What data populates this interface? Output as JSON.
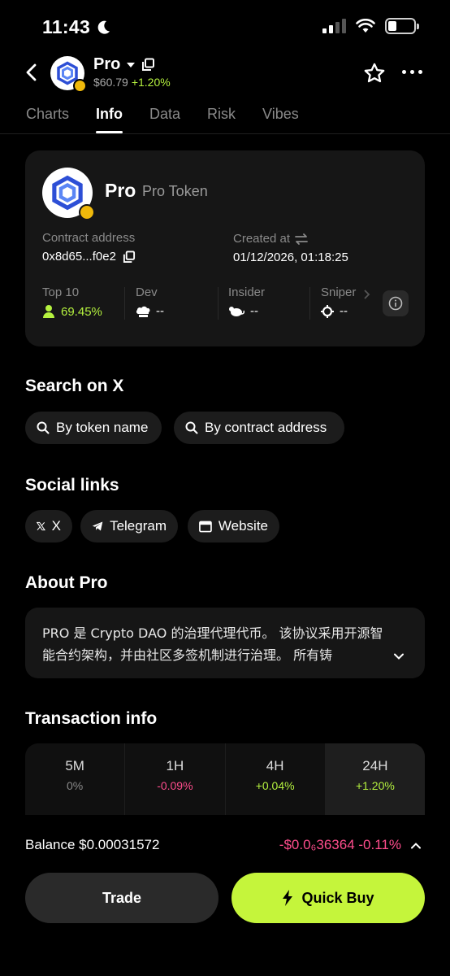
{
  "status_bar": {
    "time": "11:43"
  },
  "header": {
    "symbol": "Pro",
    "price": "$60.79",
    "change": "+1.20%"
  },
  "tabs": [
    {
      "label": "Charts",
      "active": false
    },
    {
      "label": "Info",
      "active": true
    },
    {
      "label": "Data",
      "active": false
    },
    {
      "label": "Risk",
      "active": false
    },
    {
      "label": "Vibes",
      "active": false
    }
  ],
  "token_card": {
    "symbol": "Pro",
    "full_name": "Pro Token",
    "contract_label": "Contract address",
    "contract_value": "0x8d65...f0e2",
    "created_label": "Created at",
    "created_value": "01/12/2026, 01:18:25",
    "stats": [
      {
        "label": "Top 10",
        "value": "69.45%"
      },
      {
        "label": "Dev",
        "value": "--"
      },
      {
        "label": "Insider",
        "value": "--"
      },
      {
        "label": "Sniper",
        "value": "--"
      }
    ]
  },
  "search_on_x": {
    "title": "Search on X",
    "by_name": "By token name",
    "by_contract": "By contract address"
  },
  "social_links": {
    "title": "Social links",
    "x": "X",
    "telegram": "Telegram",
    "website": "Website"
  },
  "about": {
    "title": "About Pro",
    "text": "PRO 是 Crypto DAO 的治理代理代币。 该协议采用开源智能合约架构，并由社区多签机制进行治理。 所有铸"
  },
  "transaction_info": {
    "title": "Transaction info",
    "periods": [
      {
        "label": "5M",
        "value": "0%"
      },
      {
        "label": "1H",
        "value": "-0.09%"
      },
      {
        "label": "4H",
        "value": "+0.04%"
      },
      {
        "label": "24H",
        "value": "+1.20%"
      }
    ]
  },
  "footer": {
    "balance": "Balance $0.00031572",
    "balance_change": "-$0.0₆36364 -0.11%",
    "trade_label": "Trade",
    "quick_buy_label": "Quick Buy"
  },
  "colors": {
    "accent_green": "#c5f53b",
    "positive": "#b5f23f",
    "negative": "#ff4d8d",
    "card_bg": "#161616",
    "bnb_badge": "#f0b90b"
  }
}
